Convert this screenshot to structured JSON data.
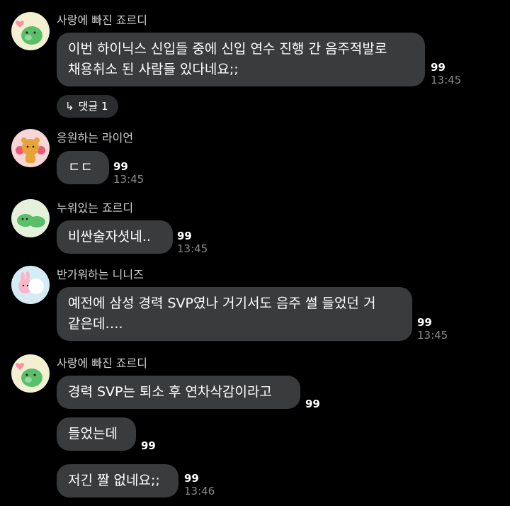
{
  "messages": [
    {
      "sender": "사랑에 빠진 죠르디",
      "lines": [
        "이번 하이닉스 신입들 중에 신입 연수 진행 간 음주적발로",
        "채용취소 된 사람들 있다네요;;"
      ],
      "unread": "99",
      "time": "13:45"
    },
    {
      "sender": "응원하는 라이언",
      "lines": [
        "ㄷㄷ"
      ],
      "unread": "99",
      "time": "13:45"
    },
    {
      "sender": "누워있는 죠르디",
      "lines": [
        "비싼술자셧네.."
      ],
      "unread": "99",
      "time": "13:45"
    },
    {
      "sender": "반가워하는 니니즈",
      "lines": [
        "예전에 삼성 경력 SVP였나 거기서도 음주 썰 들었던 거",
        "같은데…."
      ],
      "unread": "99",
      "time": "13:45"
    },
    {
      "sender": "사랑에 빠진 죠르디",
      "lines": [
        "경력 SVP는 퇴소 후 연차삭감이라고"
      ],
      "unread": "99"
    },
    {
      "lines": [
        "들었는데"
      ],
      "unread": "99"
    },
    {
      "lines": [
        "저긴 짤 없네요;;"
      ],
      "unread": "99",
      "time": "13:46"
    }
  ],
  "thread_reply": {
    "label": "댓글 1",
    "icon": "reply-arrow-icon"
  },
  "colors": {
    "background": "#000000",
    "bubble": "#3a3b3d",
    "text": "#ffffff",
    "name": "#d2d2d2",
    "time": "#8a8a8a"
  }
}
